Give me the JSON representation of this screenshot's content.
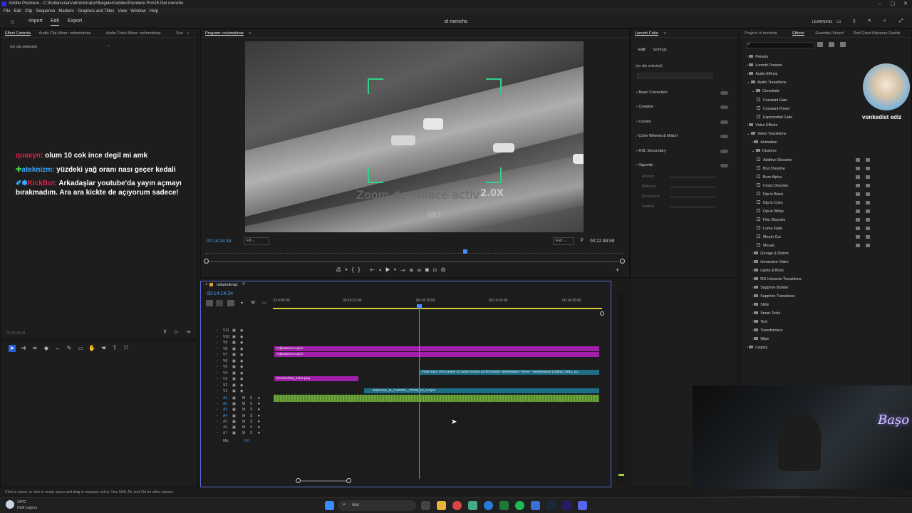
{
  "window": {
    "title": "Adobe Premiere - C:\\Kullanıcılar\\Administrator\\Belgeler\\Adobe\\Premiere Pro\\25.0\\el mencho"
  },
  "menu": [
    "File",
    "Edit",
    "Clip",
    "Sequence",
    "Markers",
    "Graphics and Titles",
    "View",
    "Window",
    "Help"
  ],
  "header": {
    "import": "Import",
    "edit": "Edit",
    "export": "Export",
    "project_name": "el mencho",
    "learning": "LEARNING"
  },
  "effect_controls": {
    "tabs": [
      "Effect Controls",
      "Audio Clip Mixer: nolumolmaz",
      "Audio Track Mixer: nolumolmaz",
      "Sou"
    ],
    "no_clip": "(no clip selected)",
    "timecode": "00:14:34:34"
  },
  "chat": [
    {
      "user": "quaxyn:",
      "user_color": "#e0234b",
      "message": "olum 10 cok ince degil mi amk"
    },
    {
      "user": "ateknizm:",
      "user_color": "#3aa8ff",
      "message": "yüzdeki yağ oranı nası geçer kedali"
    },
    {
      "user": "KickBot:",
      "user_color": "#e0234b",
      "message": "Arkadaşlar youtube'da yayın açmayı bırakmadım. Ara ara kickte de açıyorum sadece!"
    }
  ],
  "program": {
    "tab": "Program: nolumolmaz",
    "overlay_text": "Zoom de enlace activ",
    "zoom": "2.0X",
    "bottom_num": "083",
    "timecode": "00:14:14:34",
    "fit": "Fit",
    "quality": "Full",
    "duration": "00:22:48:59"
  },
  "timeline": {
    "tab": "nolumolmaz",
    "timecode": "00:14:14:34",
    "ruler": [
      "3:14:05:00",
      "00:14:10:00",
      "00:14:15:00",
      "00:14:20:00",
      "00:14:25:00"
    ],
    "video_tracks": [
      "V11",
      "V10",
      "V9",
      "V8",
      "V7",
      "V6",
      "V5",
      "V4",
      "V3",
      "V2",
      "V1"
    ],
    "audio_tracks": [
      "A1",
      "A2",
      "A3",
      "A4",
      "A5",
      "A6",
      "A7"
    ],
    "mix": "Mix",
    "mix_val": "0.0",
    "clips": {
      "adj1": "Adjustment Layer",
      "adj2": "Adjustment Layer",
      "news": "Feds warn of increase of cartel drones at the border  NewsNation Prime - NewsNation (1080p, h264, yo...",
      "screenshot": "Screenshot_1051.png",
      "welcome": "Welcome_to_CARTEL_TikTok_Pt_6.mp4"
    }
  },
  "lumetri": {
    "tab": "Lumetri Color",
    "sub_edit": "Edit",
    "sub_settings": "Settings",
    "no_clip": "(no clip selected)",
    "sections": [
      "Basic Correction",
      "Creative",
      "Curves",
      "Color Wheels & Match",
      "HSL Secondary",
      "Vignette"
    ],
    "vignette_params": [
      "Amount",
      "Midpoint",
      "Roundness",
      "Feather"
    ]
  },
  "effects": {
    "tabs": [
      "Project: el mencho",
      "Effects",
      "Essential Sound",
      "Red Giant Universe Dashb"
    ],
    "items": [
      {
        "label": "Presets",
        "level": 0,
        "folder": true
      },
      {
        "label": "Lumetri Presets",
        "level": 0,
        "folder": true
      },
      {
        "label": "Audio Effects",
        "level": 0,
        "folder": true
      },
      {
        "label": "Audio Transitions",
        "level": 0,
        "folder": true,
        "open": true
      },
      {
        "label": "Crossfade",
        "level": 1,
        "folder": true,
        "open": true
      },
      {
        "label": "Constant Gain",
        "level": 2
      },
      {
        "label": "Constant Power",
        "level": 2
      },
      {
        "label": "Exponential Fade",
        "level": 2
      },
      {
        "label": "Video Effects",
        "level": 0,
        "folder": true
      },
      {
        "label": "Video Transitions",
        "level": 0,
        "folder": true,
        "open": true
      },
      {
        "label": "Animation",
        "level": 1,
        "folder": true
      },
      {
        "label": "Dissolve",
        "level": 1,
        "folder": true,
        "open": true
      },
      {
        "label": "Additive Dissolve",
        "level": 2,
        "badges": true
      },
      {
        "label": "Blur Dissolve",
        "level": 2,
        "badges": true
      },
      {
        "label": "Burn Alpha",
        "level": 2,
        "badges": true
      },
      {
        "label": "Cross Dissolve",
        "level": 2,
        "badges": true
      },
      {
        "label": "Dip to Black",
        "level": 2,
        "badges": true
      },
      {
        "label": "Dip to Color",
        "level": 2,
        "badges": true
      },
      {
        "label": "Dip to White",
        "level": 2,
        "badges": true
      },
      {
        "label": "Film Dissolve",
        "level": 2,
        "badges": true
      },
      {
        "label": "Luma Fade",
        "level": 2,
        "badges": true
      },
      {
        "label": "Morph Cut",
        "level": 2,
        "badges": true
      },
      {
        "label": "Mosaic",
        "level": 2,
        "badges": true
      },
      {
        "label": "Grunge & Distort",
        "level": 1,
        "folder": true
      },
      {
        "label": "Immersive Video",
        "level": 1,
        "folder": true
      },
      {
        "label": "Lights & Blurs",
        "level": 1,
        "folder": true
      },
      {
        "label": "RG Universe Transitions",
        "level": 1,
        "folder": true
      },
      {
        "label": "Sapphire Builder",
        "level": 1,
        "folder": true
      },
      {
        "label": "Sapphire Transitions",
        "level": 1,
        "folder": true
      },
      {
        "label": "Slide",
        "level": 1,
        "folder": true
      },
      {
        "label": "Smart Tools",
        "level": 1,
        "folder": true
      },
      {
        "label": "Text",
        "level": 1,
        "folder": true
      },
      {
        "label": "Transformers",
        "level": 1,
        "folder": true
      },
      {
        "label": "Wipe",
        "level": 1,
        "folder": true
      },
      {
        "label": "Legacy",
        "level": 0,
        "folder": true
      }
    ]
  },
  "overlay": {
    "cat_caption": "vonkedist ediz",
    "neon": "Başo"
  },
  "status": {
    "hint": "Click to select, or click in empty space and drag to marquee select. Use Shift, Alt, and Ctrl for other options."
  },
  "taskbar": {
    "temp": "14°C",
    "weather": "Hafif yağmur",
    "search": "Ara"
  }
}
